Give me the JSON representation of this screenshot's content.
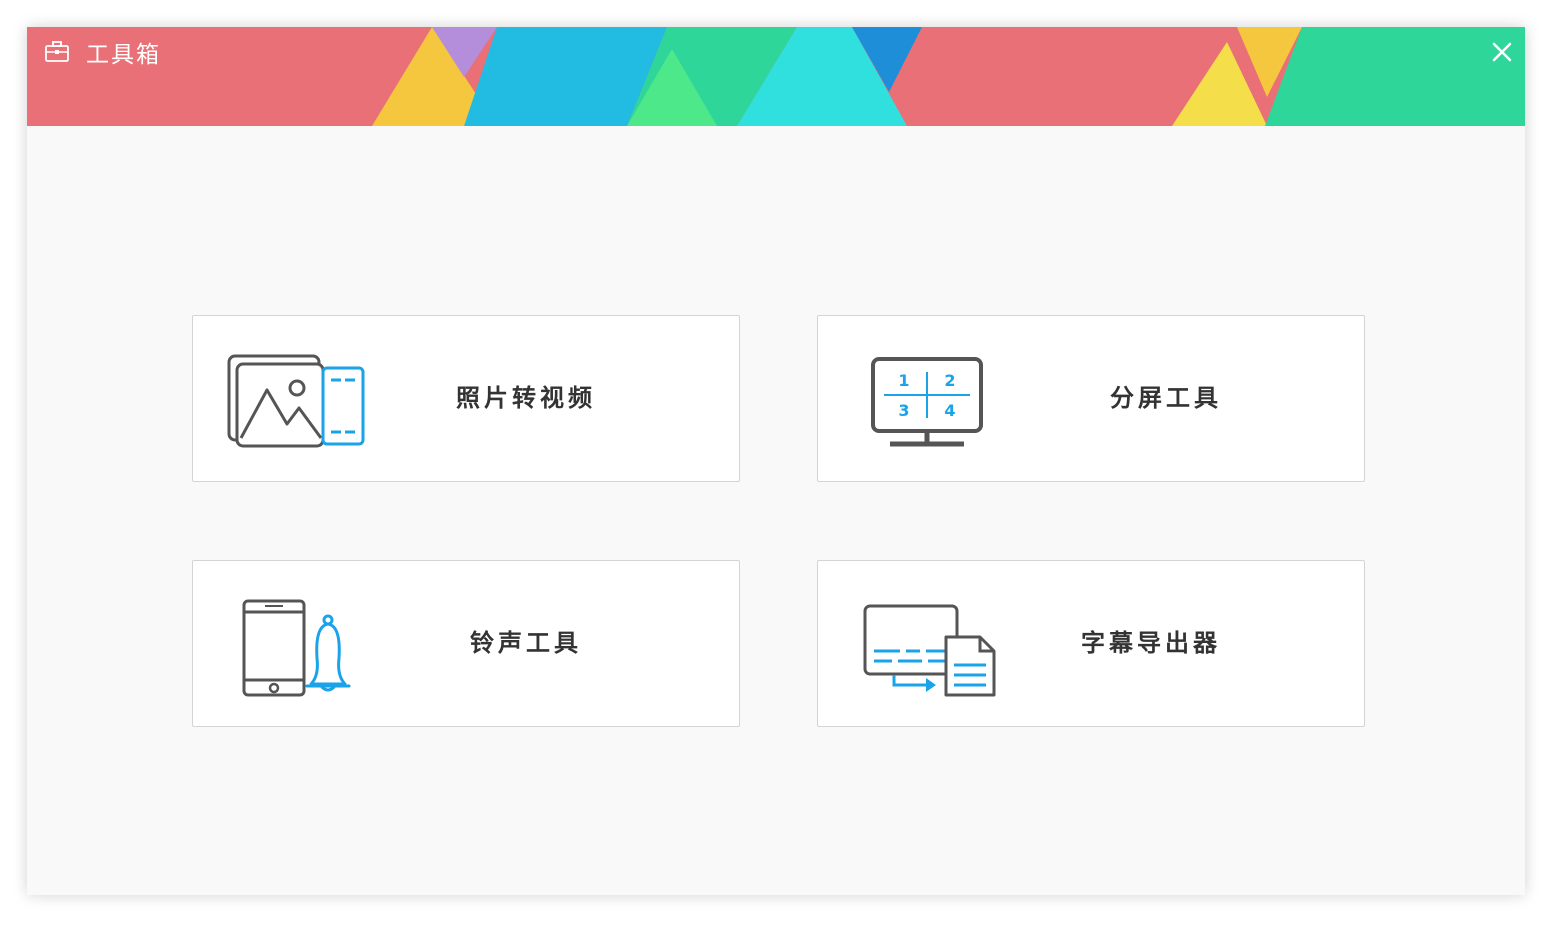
{
  "window": {
    "title": "工具箱",
    "icon": "toolbox-icon",
    "close_icon": "close-icon"
  },
  "colors": {
    "banner_red": "#e97076",
    "banner_yellow": "#f5c73f",
    "banner_purple": "#b48ddb",
    "banner_blue": "#22bbe2",
    "banner_green": "#2fd69a",
    "banner_lightgreen": "#4de88a",
    "banner_cyan": "#2fe0de",
    "banner_darkblue": "#1e8ed8",
    "icon_gray": "#555555",
    "icon_blue": "#1aa3e8"
  },
  "tools": [
    {
      "label": "照片转视频",
      "icon": "photo-to-video-icon"
    },
    {
      "label": "分屏工具",
      "icon": "split-screen-icon",
      "screen_numbers": [
        "1",
        "2",
        "3",
        "4"
      ]
    },
    {
      "label": "铃声工具",
      "icon": "ringtone-icon"
    },
    {
      "label": "字幕导出器",
      "icon": "subtitle-export-icon"
    }
  ]
}
